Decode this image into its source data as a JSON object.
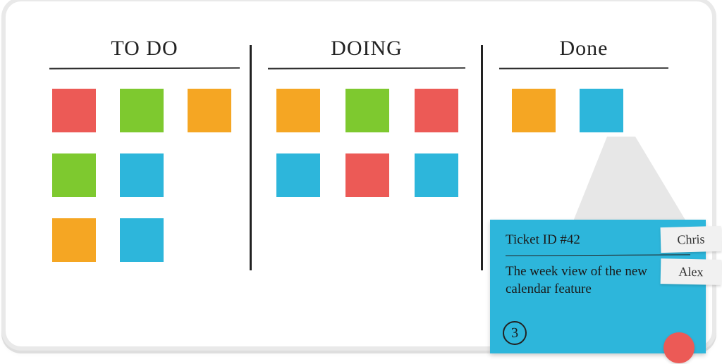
{
  "colors": {
    "red": "#ec5a56",
    "green": "#7ec92f",
    "orange": "#f5a623",
    "blue": "#2db6db"
  },
  "columns": {
    "todo": {
      "title": "TO DO",
      "cards": [
        "red",
        "green",
        "orange",
        "green",
        "blue",
        "",
        "orange",
        "blue"
      ]
    },
    "doing": {
      "title": "DOING",
      "cards": [
        "orange",
        "green",
        "red",
        "blue",
        "red",
        "blue"
      ]
    },
    "done": {
      "title": "Done",
      "cards": [
        "orange",
        "blue"
      ]
    }
  },
  "detail": {
    "source_card": {
      "column": "done",
      "index": 1
    },
    "ticket_label": "Ticket ID #42",
    "description": "The week view of the new calendar feature",
    "points": "3",
    "assignees": [
      "Chris",
      "Alex"
    ],
    "flag_color": "red"
  }
}
